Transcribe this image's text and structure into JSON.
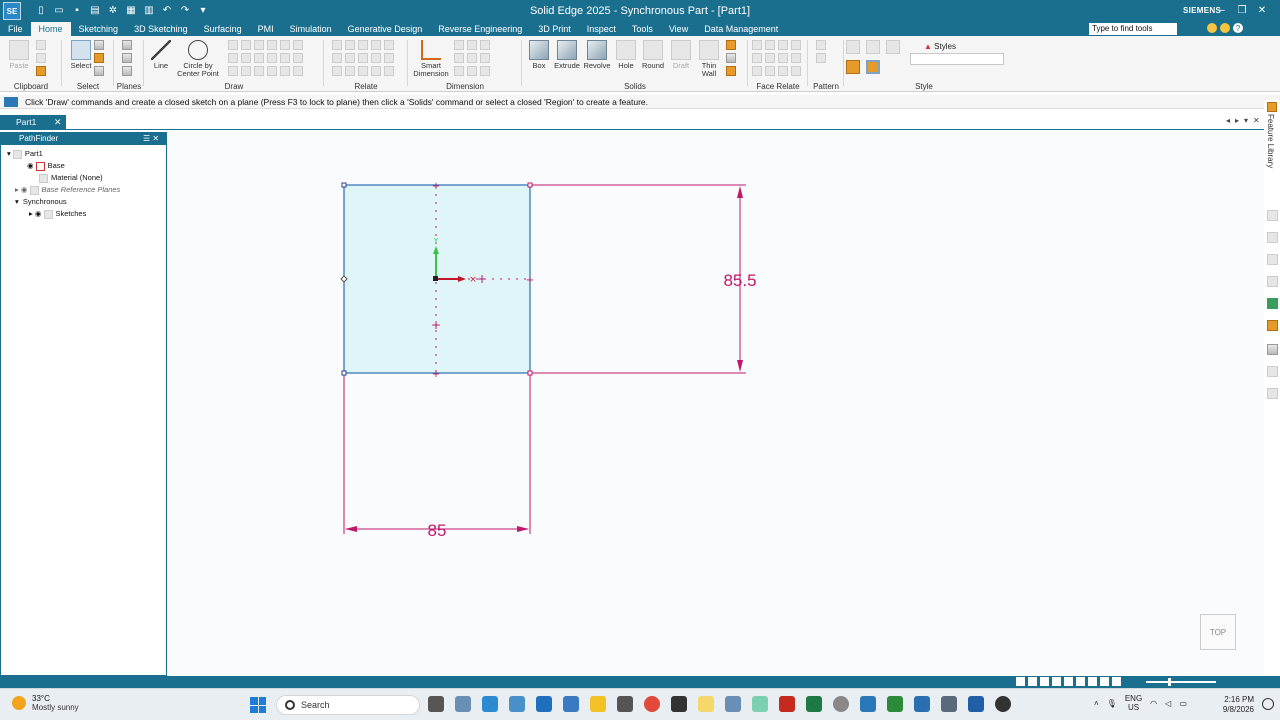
{
  "window": {
    "title": "Solid Edge 2025 - Synchronous Part - [Part1]",
    "brand": "SIEMENS",
    "app_logo": "SE"
  },
  "menu": {
    "tabs": [
      "File",
      "Home",
      "Sketching",
      "3D Sketching",
      "Surfacing",
      "PMI",
      "Simulation",
      "Generative Design",
      "Reverse Engineering",
      "3D Print",
      "Inspect",
      "Tools",
      "View",
      "Data Management"
    ],
    "active_tab": "Home",
    "find_placeholder": "Type to find tools"
  },
  "ribbon": {
    "groups": {
      "clipboard": "Clipboard",
      "select": "Select",
      "planes": "Planes",
      "draw": "Draw",
      "relate": "Relate",
      "dimension": "Dimension",
      "solids": "Solids",
      "face_relate": "Face Relate",
      "pattern": "Pattern",
      "style": "Style"
    },
    "buttons": {
      "paste": "Paste",
      "select": "Select",
      "line": "Line",
      "circle1": "Circle by",
      "circle2": "Center Point",
      "smart_dim1": "Smart",
      "smart_dim2": "Dimension",
      "box": "Box",
      "extrude": "Extrude",
      "revolve": "Revolve",
      "hole": "Hole",
      "round": "Round",
      "draft": "Draft",
      "thin_wall1": "Thin",
      "thin_wall2": "Wall",
      "styles": "Styles"
    }
  },
  "prompt": {
    "text": "Click 'Draw' commands and create a closed sketch on a plane (Press F3 to lock to plane) then click a 'Solids' command or select a closed 'Region' to create a feature."
  },
  "document": {
    "tab": "Part1"
  },
  "pathfinder": {
    "title": "PathFinder",
    "items": [
      {
        "label": "Part1"
      },
      {
        "label": "Base"
      },
      {
        "label": "Material (None)"
      },
      {
        "label": "Base Reference Planes"
      },
      {
        "label": "Synchronous"
      },
      {
        "label": "Sketches"
      }
    ]
  },
  "sketch": {
    "width_dim": "85",
    "height_dim": "85.5",
    "axis_x": "X",
    "axis_y": "Y",
    "colors": {
      "fill": "#dff5f7",
      "outline": "#2b6fb0",
      "dimension": "#c0176b"
    }
  },
  "viewcube": {
    "label": "TOP"
  },
  "rightdock": {
    "label": "Feature Library"
  },
  "taskbar": {
    "weather_temp": "33°C",
    "weather_desc": "Mostly sunny",
    "search": "Search",
    "lang1": "ENG",
    "lang2": "US",
    "time": "2:16 PM",
    "date": "9/8/2026"
  }
}
